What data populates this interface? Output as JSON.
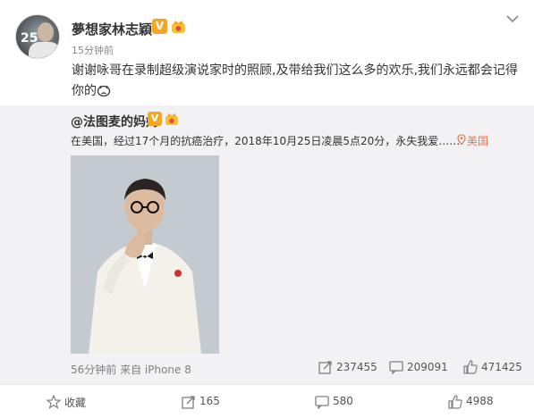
{
  "post": {
    "username": "夢想家林志穎",
    "verified_badge": "V",
    "timestamp": "15分钟前",
    "text": "谢谢咏哥在录制超级演说家时的照顾,及带给我们这么多的欢乐,我们永远都会记得你的",
    "avatar_overlay": "25"
  },
  "repost": {
    "author": "@法图麦的妈妈",
    "verified_badge": "V",
    "text": "在美国，经过17个月的抗癌治疗，2018年10月25日凌晨5点20分，永失我爱……",
    "location": "美国",
    "meta": "56分钟前 来自 iPhone 8",
    "stats": {
      "reposts": "237455",
      "comments": "209091",
      "likes": "471425"
    }
  },
  "actions": {
    "favorite_label": "收藏",
    "repost_count": "165",
    "comment_count": "580",
    "like_count": "4988"
  },
  "colors": {
    "accent_orange": "#eb7350",
    "badge_gold": "#f5a623",
    "repost_bg": "#f2f2f5"
  }
}
